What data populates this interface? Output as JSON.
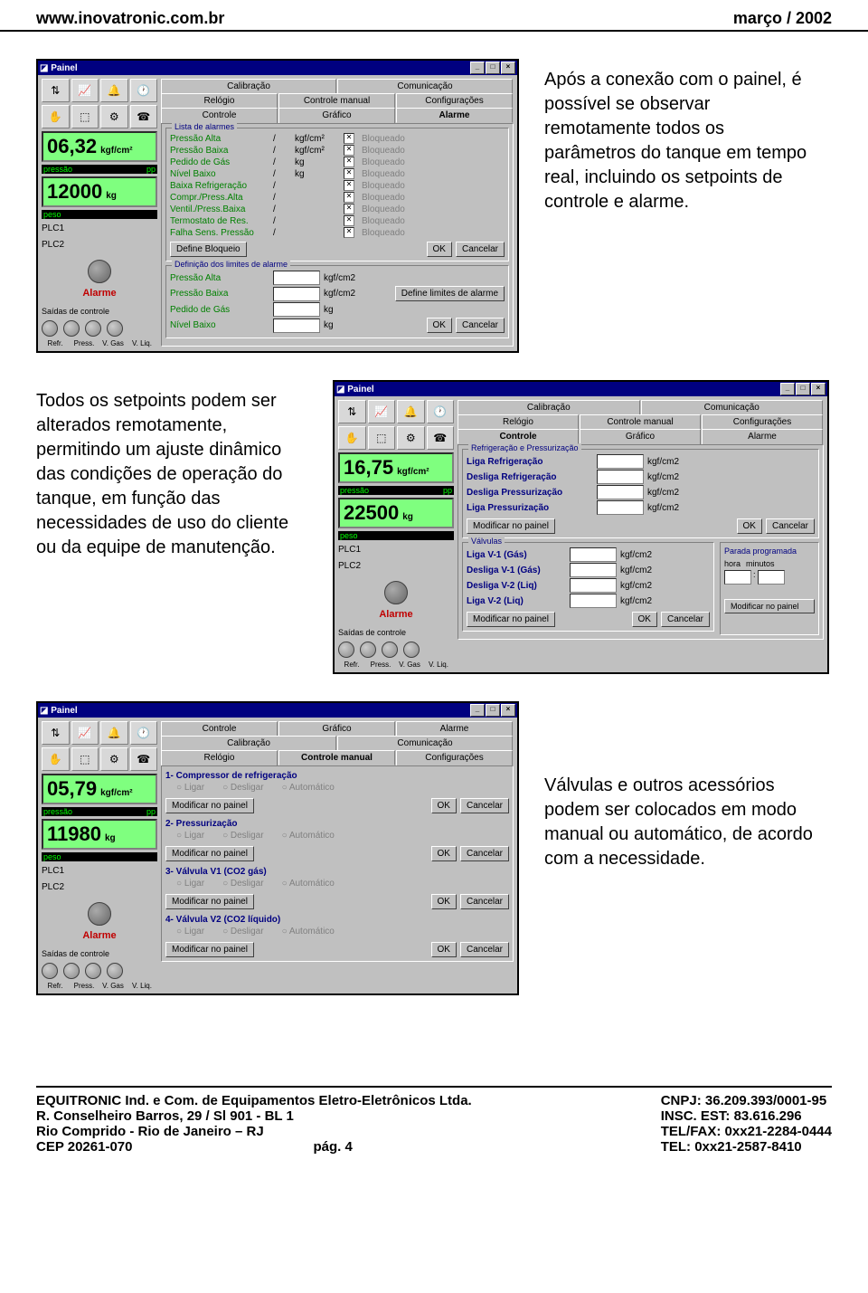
{
  "header": {
    "url": "www.inovatronic.com.br",
    "date": "março / 2002"
  },
  "caption1": "Após a conexão com o painel, é possível se observar remotamente todos os parâmetros do tanque em tempo real, incluindo os setpoints de controle e alarme.",
  "caption2": "Todos os setpoints podem ser alterados remotamente, permitindo um ajuste dinâmico das condições de operação do tanque, em função das necessidades de uso do cliente ou da equipe de manutenção.",
  "caption3": "Válvulas e outros acessórios podem ser colocados em modo manual ou automático, de acordo com a necessidade.",
  "win_title": "Painel",
  "tabs": {
    "calib": "Calibração",
    "comun": "Comunicação",
    "relog": "Relógio",
    "cman": "Controle manual",
    "config": "Configurações",
    "ctrl": "Controle",
    "graf": "Gráfico",
    "alarm": "Alarme"
  },
  "left": {
    "pressao_lbl": "pressão",
    "pp": "pp",
    "peso_lbl": "peso",
    "plc1": "PLC1",
    "plc2": "PLC2",
    "alarme": "Alarme",
    "saidas": "Saídas de controle",
    "s1": "Refr.",
    "s2": "Press.",
    "s3": "V. Gas",
    "s4": "V. Liq."
  },
  "p1": {
    "press": "06,32",
    "press_u": "kgf/cm²",
    "peso": "12000",
    "peso_u": "kg",
    "grp1": "Lista de alarmes",
    "rows": [
      {
        "n": "Pressão Alta",
        "v": "/",
        "u": "kgf/cm²"
      },
      {
        "n": "Pressão Baixa",
        "v": "/",
        "u": "kgf/cm²"
      },
      {
        "n": "Pedido de Gás",
        "v": "/",
        "u": "kg"
      },
      {
        "n": "Nível Baixo",
        "v": "/",
        "u": "kg"
      },
      {
        "n": "Baixa Refrigeração",
        "v": "/",
        "u": ""
      },
      {
        "n": "Compr./Press.Alta",
        "v": "/",
        "u": ""
      },
      {
        "n": "Ventil./Press.Baixa",
        "v": "/",
        "u": ""
      },
      {
        "n": "Termostato de Res.",
        "v": "/",
        "u": ""
      },
      {
        "n": "Falha Sens. Pressão",
        "v": "/",
        "u": ""
      }
    ],
    "btn_bloq": "Define Bloqueio",
    "btn_ok": "OK",
    "btn_cancel": "Cancelar",
    "grp2": "Definição dos limites de alarme",
    "lim": [
      {
        "n": "Pressão Alta",
        "u": "kgf/cm2"
      },
      {
        "n": "Pressão Baixa",
        "u": "kgf/cm2"
      },
      {
        "n": "Pedido de Gás",
        "u": "kg"
      },
      {
        "n": "Nível Baixo",
        "u": "kg"
      }
    ],
    "btn_def": "Define limites de alarme"
  },
  "p2": {
    "press": "16,75",
    "press_u": "kgf/cm²",
    "peso": "22500",
    "peso_u": "kg",
    "grp1": "Refrigeração e Pressurização",
    "rows1": [
      {
        "n": "Liga Refrigeração",
        "u": "kgf/cm2"
      },
      {
        "n": "Desliga Refrigeração",
        "u": "kgf/cm2"
      },
      {
        "n": "Desliga Pressurização",
        "u": "kgf/cm2"
      },
      {
        "n": "Liga Pressurização",
        "u": "kgf/cm2"
      }
    ],
    "btn_mod": "Modificar no painel",
    "grp2": "Válvulas",
    "rows2": [
      {
        "n": "Liga V-1 (Gás)",
        "u": "kgf/cm2"
      },
      {
        "n": "Desliga V-1 (Gás)",
        "u": "kgf/cm2"
      },
      {
        "n": "Desliga V-2 (Liq)",
        "u": "kgf/cm2"
      },
      {
        "n": "Liga V-2 (Liq)",
        "u": "kgf/cm2"
      }
    ],
    "parada": "Parada programada",
    "hora": "hora",
    "min": "minutos"
  },
  "p3": {
    "press": "05,79",
    "press_u": "kgf/cm²",
    "peso": "11980",
    "peso_u": "kg",
    "s1": "1- Compressor de refrigeração",
    "s2": "2- Pressurização",
    "s3": "3- Válvula V1 (CO2 gás)",
    "s4": "4- Válvula V2 (CO2 líquido)",
    "mod": "Modificar no painel"
  },
  "footer": {
    "l1": "EQUITRONIC  Ind. e Com. de Equipamentos Eletro-Eletrônicos Ltda.",
    "l2": "R. Conselheiro Barros, 29 / Sl 901 - BL 1",
    "l3": "Rio Comprido - Rio de Janeiro – RJ",
    "l4": "CEP 20261-070",
    "r1": "CNPJ: 36.209.393/0001-95",
    "r2": "INSC. EST: 83.616.296",
    "r3": "TEL/FAX: 0xx21-2284-0444",
    "r4": "TEL: 0xx21-2587-8410",
    "pg": "pág. 4"
  }
}
